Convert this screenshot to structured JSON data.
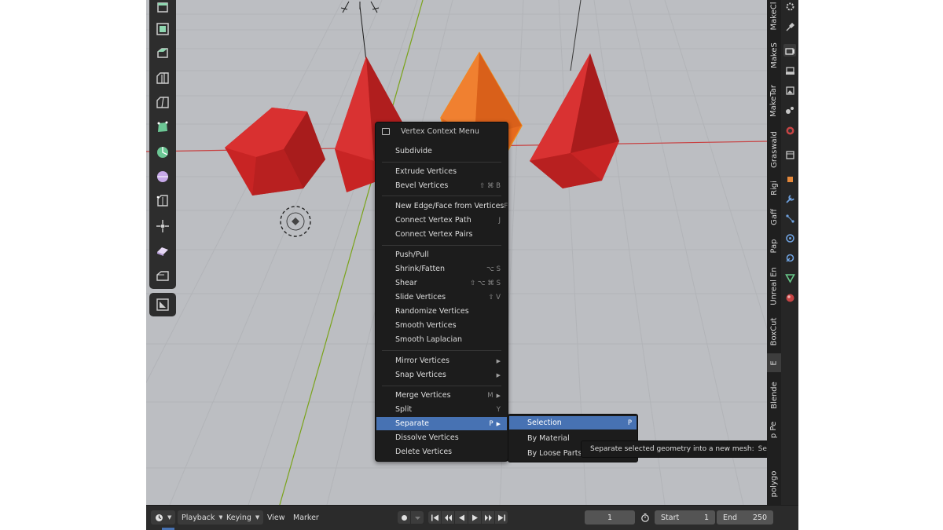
{
  "context_menu": {
    "title": "Vertex Context Menu",
    "items": [
      {
        "label": "Subdivide",
        "shortcut": ""
      },
      {
        "label": "Extrude Vertices",
        "shortcut": ""
      },
      {
        "label": "Bevel Vertices",
        "shortcut": "⇧ ⌘ B"
      },
      {
        "label": "New Edge/Face from Vertices",
        "shortcut": "F"
      },
      {
        "label": "Connect Vertex Path",
        "shortcut": "J"
      },
      {
        "label": "Connect Vertex Pairs",
        "shortcut": ""
      },
      {
        "label": "Push/Pull",
        "shortcut": ""
      },
      {
        "label": "Shrink/Fatten",
        "shortcut": "⌥ S"
      },
      {
        "label": "Shear",
        "shortcut": "⇧ ⌥ ⌘ S"
      },
      {
        "label": "Slide Vertices",
        "shortcut": "⇧ V"
      },
      {
        "label": "Randomize Vertices",
        "shortcut": ""
      },
      {
        "label": "Smooth Vertices",
        "shortcut": ""
      },
      {
        "label": "Smooth Laplacian",
        "shortcut": ""
      },
      {
        "label": "Mirror Vertices",
        "shortcut": ""
      },
      {
        "label": "Snap Vertices",
        "shortcut": ""
      },
      {
        "label": "Merge Vertices",
        "shortcut": "M"
      },
      {
        "label": "Split",
        "shortcut": "Y"
      },
      {
        "label": "Separate",
        "shortcut": "P"
      },
      {
        "label": "Dissolve Vertices",
        "shortcut": ""
      },
      {
        "label": "Delete Vertices",
        "shortcut": ""
      }
    ]
  },
  "separate_submenu": {
    "items": [
      {
        "label": "Selection",
        "shortcut": "P"
      },
      {
        "label": "By Material",
        "shortcut": ""
      },
      {
        "label": "By Loose Parts",
        "shortcut": ""
      }
    ]
  },
  "tooltip": {
    "text": "Separate selected geometry into a new mesh:",
    "value": "Selection"
  },
  "sidebar_tabs": [
    "MakeCl",
    "MakeS",
    "MakeTar",
    "Graswald",
    "Rigi",
    "Gaff",
    "Pap",
    "Unreal En",
    "BoxCut",
    "E",
    "Blende",
    "p Pe",
    "polygo"
  ],
  "timeline": {
    "playback": "Playback",
    "keying": "Keying",
    "view": "View",
    "marker": "Marker",
    "current_frame": "1",
    "start_label": "Start",
    "start_value": "1",
    "end_label": "End",
    "end_value": "250"
  },
  "colors": {
    "mesh_red": "#d42b2b",
    "selection_orange": "#f07818",
    "menu_highlight": "#4772b3",
    "viewport_bg": "#bcbec2"
  }
}
